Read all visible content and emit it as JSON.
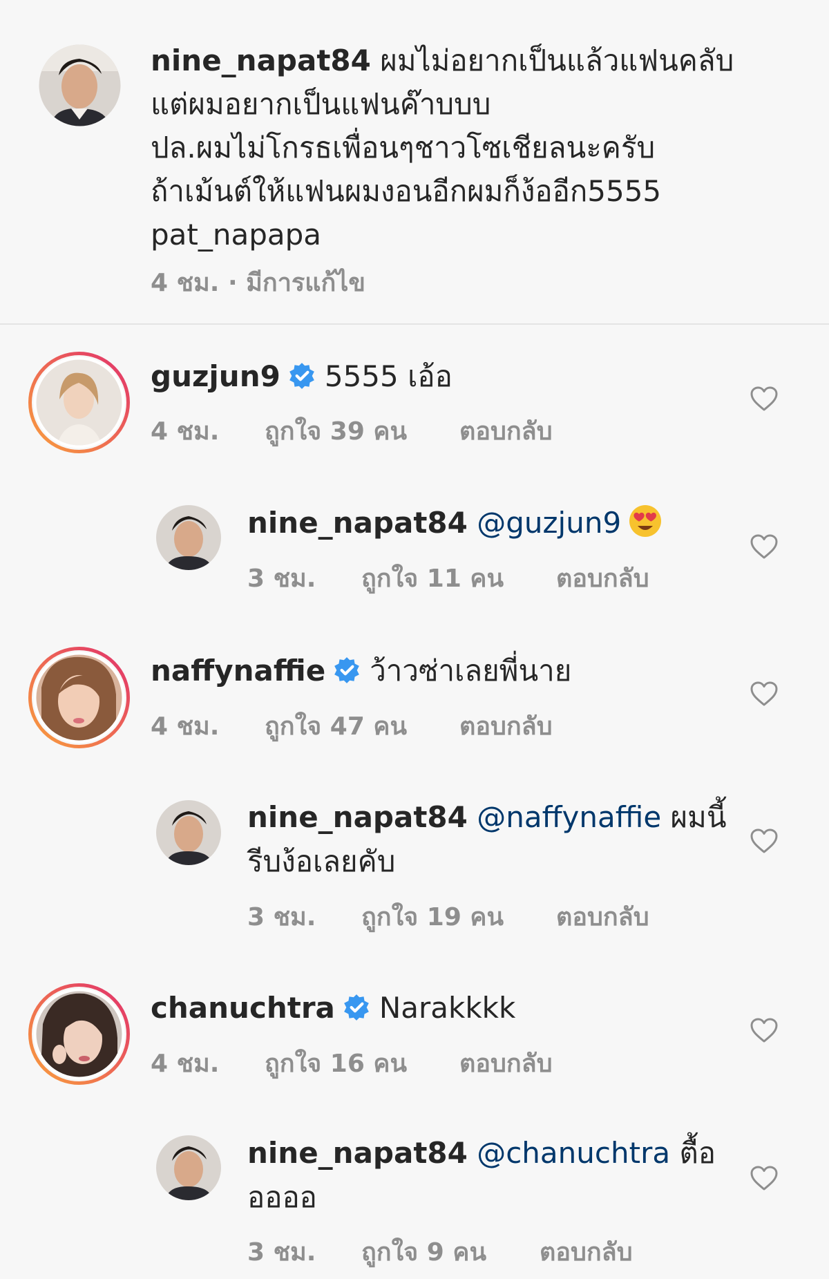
{
  "caption": {
    "username": "nine_napat84",
    "lines": [
      "ผมไม่อยากเป็นแล้วแฟนคลับ",
      "แต่ผมอยากเป็นแฟนค๊าบบบ",
      "ปล.ผมไม่โกรธเพื่อนๆชาวโซเชียลนะครับ",
      "ถ้าเม้นต์ให้แฟนผมงอนอีกผมก็ง้ออีก5555",
      "pat_napapa"
    ],
    "time": "4 ชม.",
    "edited": "· มีการแก้ไข"
  },
  "comments": [
    {
      "username": "guzjun9",
      "verified": true,
      "text": "5555 เอ้อ",
      "time": "4 ชม.",
      "likes": "ถูกใจ 39 คน",
      "reply_label": "ตอบกลับ"
    },
    {
      "username": "nine_napat84",
      "mention": "@guzjun9",
      "text": "",
      "emoji": "heart-eyes-emoji",
      "time": "3 ชม.",
      "likes": "ถูกใจ 11 คน",
      "reply_label": "ตอบกลับ"
    },
    {
      "username": "naffynaffie",
      "verified": true,
      "text": "ว้าวซ่าเลยพี่นาย",
      "time": "4 ชม.",
      "likes": "ถูกใจ 47 คน",
      "reply_label": "ตอบกลับ"
    },
    {
      "username": "nine_napat84",
      "mention": "@naffynaffie",
      "text": "ผมนี้",
      "text2": "รีบง้อเลยคับ",
      "time": "3 ชม.",
      "likes": "ถูกใจ 19 คน",
      "reply_label": "ตอบกลับ"
    },
    {
      "username": "chanuchtra",
      "verified": true,
      "text": "Narakkkk",
      "time": "4 ชม.",
      "likes": "ถูกใจ 16 คน",
      "reply_label": "ตอบกลับ"
    },
    {
      "username": "nine_napat84",
      "mention": "@chanuchtra",
      "text": "ตื้อ",
      "text2": "ออออ",
      "time": "3 ชม.",
      "likes": "ถูกใจ 9 คน",
      "reply_label": "ตอบกลับ"
    }
  ],
  "colors": {
    "background": "#f7f7f7",
    "text": "#262626",
    "meta": "#8e8e8e",
    "mention": "#00376b",
    "verified": "#3897f0",
    "story_ring_start": "#f9a03c",
    "story_ring_end": "#e1306c"
  }
}
